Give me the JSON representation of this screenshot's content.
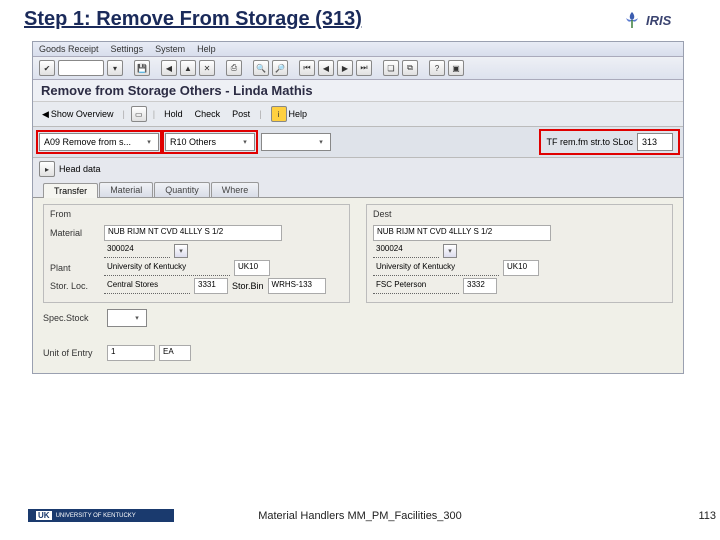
{
  "slide": {
    "title": "Step 1: Remove From Storage (313)",
    "logo_text": "IRIS"
  },
  "menu": {
    "items": [
      "Goods Receipt",
      "Settings",
      "System",
      "Help"
    ]
  },
  "screen_title": "Remove from Storage Others - Linda Mathis",
  "toolbar2": {
    "show_overview": "Show Overview",
    "hold": "Hold",
    "check": "Check",
    "post": "Post",
    "help": "Help"
  },
  "selectors": {
    "action": "A09 Remove from s...",
    "ref": "R10 Others",
    "mvmt_label": "TF rem.fm str.to SLoc",
    "mvmt_code": "313"
  },
  "head_data": "Head data",
  "tabs": [
    "Transfer",
    "Material",
    "Quantity",
    "Where"
  ],
  "from": {
    "title": "From",
    "material_label": "Material",
    "material_desc": "NUB RIJM NT CVD 4LLLY S 1/2",
    "material_code": "300024",
    "plant_label": "Plant",
    "plant_desc": "University of Kentucky",
    "plant_code": "UK10",
    "stor_label": "Stor. Loc.",
    "stor_desc": "Central Stores",
    "stor_code": "3331",
    "storbin_label": "Stor.Bin",
    "storbin_val": "WRHS-133"
  },
  "dest": {
    "title": "Dest",
    "material_desc": "NUB RIJM NT CVD 4LLLY S 1/2",
    "material_code": "300024",
    "plant_desc": "University of Kentucky",
    "plant_code": "UK10",
    "stor_desc": "FSC Peterson",
    "stor_code": "3332"
  },
  "spec_stock": {
    "label": "Spec.Stock"
  },
  "unit_entry": {
    "label": "Unit of Entry",
    "qty": "1",
    "uom": "EA"
  },
  "footer": {
    "uk": "UNIVERSITY OF KENTUCKY",
    "center": "Material Handlers MM_PM_Facilities_300",
    "page": "113"
  }
}
